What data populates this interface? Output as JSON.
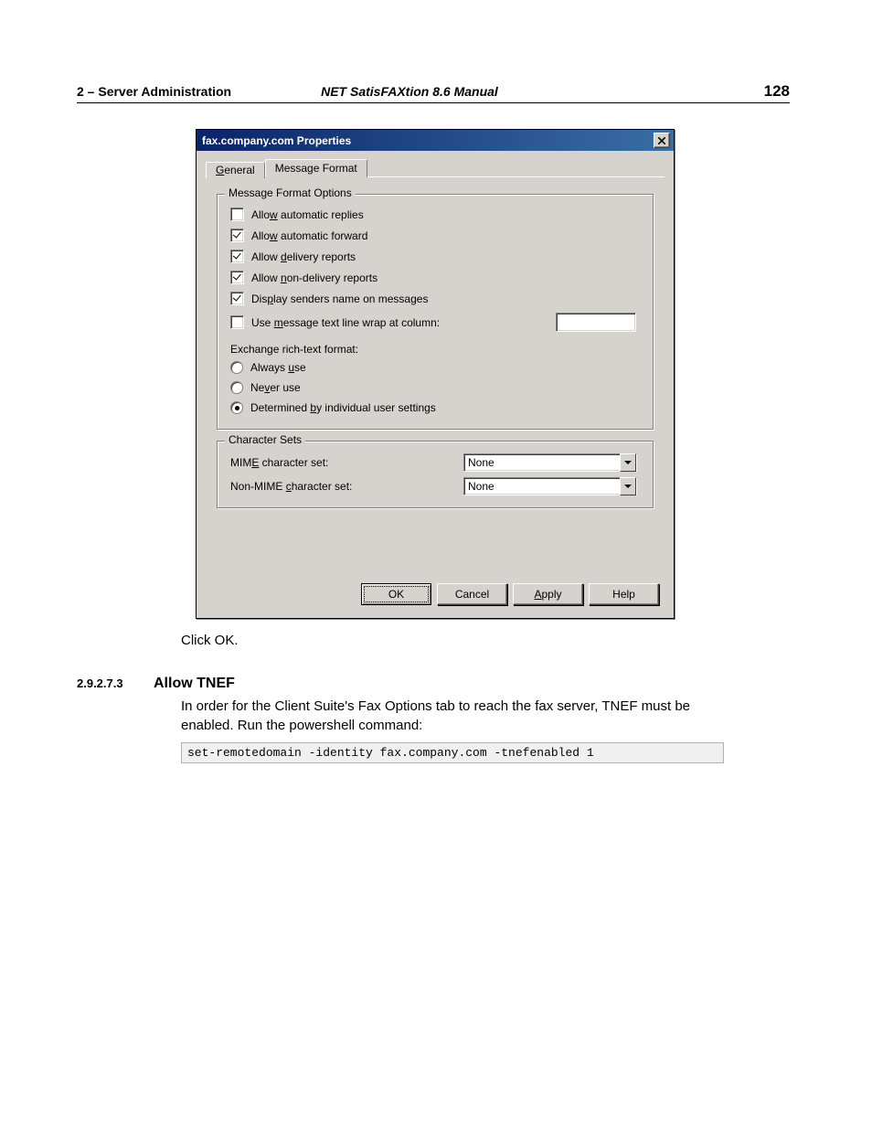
{
  "header": {
    "left": "2  – Server Administration",
    "center": "NET SatisFAXtion 8.6 Manual",
    "page_number": "128"
  },
  "dialog": {
    "title": "fax.company.com Properties",
    "tabs": {
      "general": "General",
      "message_format": "Message Format"
    },
    "group1_legend": "Message Format Options",
    "checks": {
      "auto_replies": {
        "pre": "Allo",
        "u": "w",
        "post": " automatic replies",
        "checked": false
      },
      "auto_forward": {
        "pre": "Allo",
        "u": "w",
        "post": " automatic forward",
        "checked": true
      },
      "delivery": {
        "pre": "Allow ",
        "u": "d",
        "post": "elivery reports",
        "checked": true
      },
      "non_delivery": {
        "pre": "Allow ",
        "u": "n",
        "post": "on-delivery reports",
        "checked": true
      },
      "display_sender": {
        "pre": "Dis",
        "u": "p",
        "post": "lay senders name on messages",
        "checked": true
      },
      "line_wrap": {
        "pre": "Use ",
        "u": "m",
        "post": "essage text line wrap at column:",
        "checked": false
      }
    },
    "rtf_label": "Exchange rich-text format:",
    "radios": {
      "always": {
        "pre": "Always ",
        "u": "u",
        "post": "se",
        "selected": false
      },
      "never": {
        "pre": "Ne",
        "u": "v",
        "post": "er use",
        "selected": false
      },
      "determined": {
        "pre": "Determined ",
        "u": "b",
        "post": "y individual user settings",
        "selected": true
      }
    },
    "group2_legend": "Character Sets",
    "charsets": {
      "mime": {
        "pre": "MIM",
        "u": "E",
        "post": " character set:",
        "value": "None"
      },
      "non_mime": {
        "pre": "Non-MIME ",
        "u": "c",
        "post": "haracter set:",
        "value": "None"
      }
    },
    "buttons": {
      "ok": "OK",
      "cancel": "Cancel",
      "apply_pre": "",
      "apply_u": "A",
      "apply_post": "pply",
      "help": "Help"
    }
  },
  "body": {
    "click_ok": "Click OK.",
    "section_num": "2.9.2.7.3",
    "section_title": "Allow TNEF",
    "tnef_para": "In order for the Client Suite's Fax Options tab to reach the fax server, TNEF must be enabled. Run the powershell command:",
    "code": "set-remotedomain -identity fax.company.com -tnefenabled 1"
  }
}
